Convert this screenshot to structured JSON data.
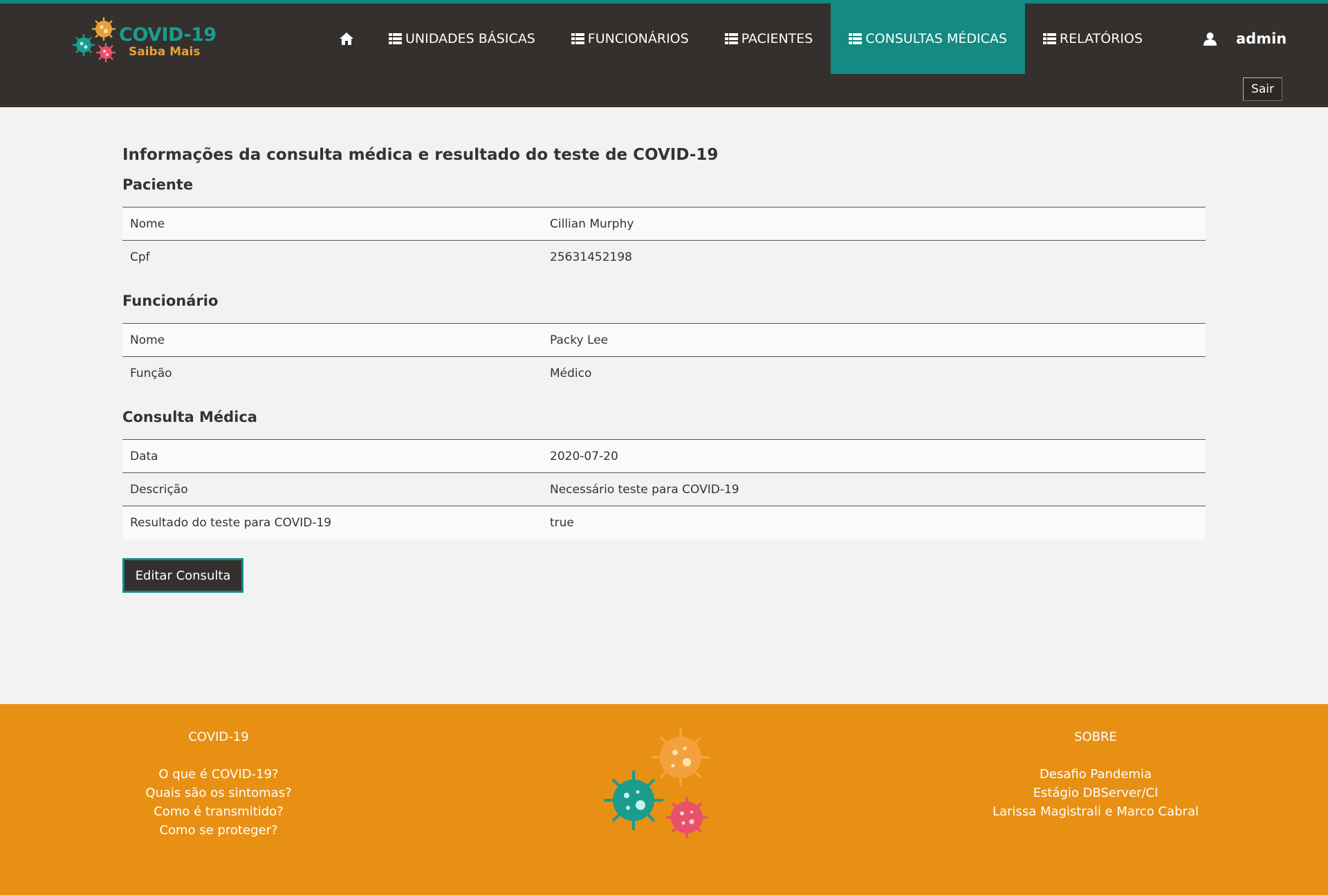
{
  "brand": {
    "line1": "COVID-19",
    "line2": "Saiba Mais"
  },
  "nav": {
    "home_icon": "home-icon",
    "items": [
      {
        "label": "UNIDADES BÁSICAS",
        "icon": "list-icon"
      },
      {
        "label": "FUNCIONÁRIOS",
        "icon": "list-icon"
      },
      {
        "label": "PACIENTES",
        "icon": "list-icon"
      },
      {
        "label": "CONSULTAS MÉDICAS",
        "icon": "list-icon",
        "active": true
      },
      {
        "label": "RELATÓRIOS",
        "icon": "list-icon"
      }
    ],
    "user": {
      "icon": "user-icon",
      "name": "admin"
    },
    "logout_label": "Sair"
  },
  "page": {
    "title": "Informações da consulta médica e resultado do teste de COVID-19",
    "paciente": {
      "heading": "Paciente",
      "rows": [
        {
          "key": "Nome",
          "value": "Cillian Murphy"
        },
        {
          "key": "Cpf",
          "value": "25631452198"
        }
      ]
    },
    "funcionario": {
      "heading": "Funcionário",
      "rows": [
        {
          "key": "Nome",
          "value": "Packy Lee"
        },
        {
          "key": "Função",
          "value": "Médico"
        }
      ]
    },
    "consulta": {
      "heading": "Consulta Médica",
      "rows": [
        {
          "key": "Data",
          "value": "2020-07-20"
        },
        {
          "key": "Descrição",
          "value": "Necessário teste para COVID-19"
        },
        {
          "key": "Resultado do teste para COVID-19",
          "value": "true"
        }
      ]
    },
    "edit_button": "Editar Consulta"
  },
  "footer": {
    "left": {
      "heading": "COVID-19",
      "links": [
        "O que é COVID-19?",
        "Quais são os sintomas?",
        "Como é transmitido?",
        "Como se proteger?"
      ]
    },
    "right": {
      "heading": "SOBRE",
      "lines": [
        "Desafio Pandemia",
        "Estágio DBServer/CI",
        "Larissa Magistrali e Marco Cabral"
      ]
    }
  },
  "colors": {
    "topbar": "#33302e",
    "accent": "#138a82",
    "footer": "#e89014",
    "background": "#f2f2f2"
  }
}
